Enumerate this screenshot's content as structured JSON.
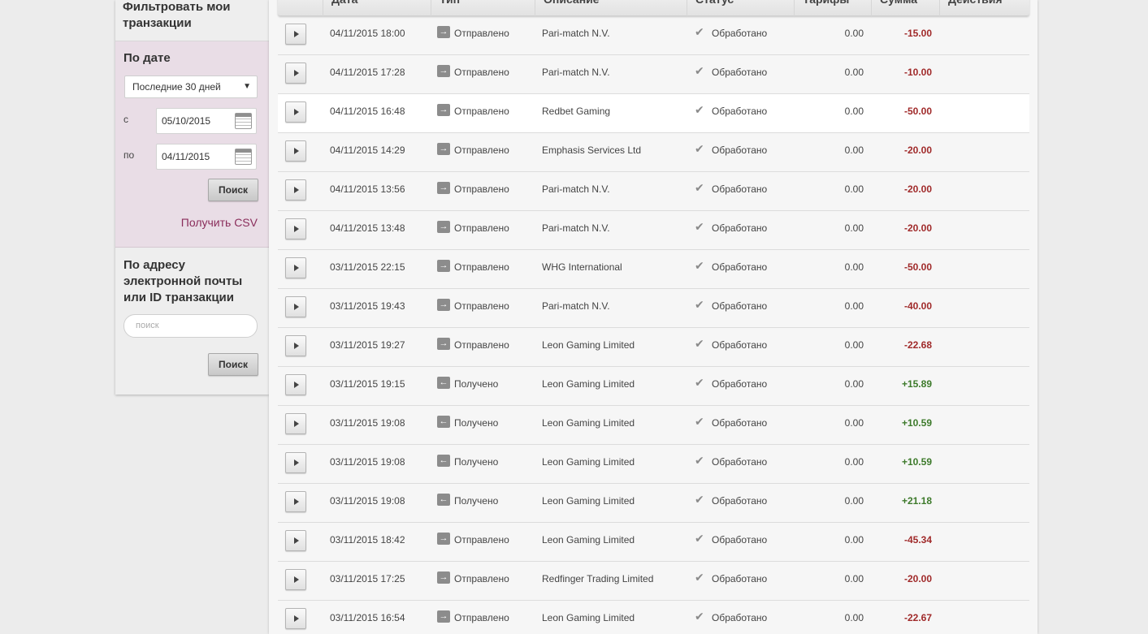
{
  "sidebar": {
    "heading": "Фильтровать мои транзакции",
    "date_section_title": "По дате",
    "period_select": "Последние 30 дней",
    "from_label": "с",
    "from_date": "05/10/2015",
    "to_label": "по",
    "to_date": "04/11/2015",
    "search_button": "Поиск",
    "csv_link": "Получить CSV",
    "email_section_title": "По адресу электронной почты или ID транзакции",
    "search_placeholder": "поиск",
    "email_search_button": "Поиск"
  },
  "table": {
    "headers": [
      "Дата",
      "Тип",
      "Описание",
      "Статус",
      "Тарифы",
      "Сумма",
      "Действия"
    ],
    "rows": [
      {
        "date": "04/11/2015 18:00",
        "type": "Отправлено",
        "dir": "out",
        "desc": "Pari-match N.V.",
        "status": "Обработано",
        "fee": "0.00",
        "amount": "-15.00"
      },
      {
        "date": "04/11/2015 17:28",
        "type": "Отправлено",
        "dir": "out",
        "desc": "Pari-match N.V.",
        "status": "Обработано",
        "fee": "0.00",
        "amount": "-10.00"
      },
      {
        "date": "04/11/2015 16:48",
        "type": "Отправлено",
        "dir": "out",
        "desc": "Redbet Gaming",
        "status": "Обработано",
        "fee": "0.00",
        "amount": "-50.00"
      },
      {
        "date": "04/11/2015 14:29",
        "type": "Отправлено",
        "dir": "out",
        "desc": "Emphasis Services Ltd",
        "status": "Обработано",
        "fee": "0.00",
        "amount": "-20.00"
      },
      {
        "date": "04/11/2015 13:56",
        "type": "Отправлено",
        "dir": "out",
        "desc": "Pari-match N.V.",
        "status": "Обработано",
        "fee": "0.00",
        "amount": "-20.00"
      },
      {
        "date": "04/11/2015 13:48",
        "type": "Отправлено",
        "dir": "out",
        "desc": "Pari-match N.V.",
        "status": "Обработано",
        "fee": "0.00",
        "amount": "-20.00"
      },
      {
        "date": "03/11/2015 22:15",
        "type": "Отправлено",
        "dir": "out",
        "desc": "WHG International",
        "status": "Обработано",
        "fee": "0.00",
        "amount": "-50.00"
      },
      {
        "date": "03/11/2015 19:43",
        "type": "Отправлено",
        "dir": "out",
        "desc": "Pari-match N.V.",
        "status": "Обработано",
        "fee": "0.00",
        "amount": "-40.00"
      },
      {
        "date": "03/11/2015 19:27",
        "type": "Отправлено",
        "dir": "out",
        "desc": "Leon Gaming Limited",
        "status": "Обработано",
        "fee": "0.00",
        "amount": "-22.68"
      },
      {
        "date": "03/11/2015 19:15",
        "type": "Получено",
        "dir": "in",
        "desc": "Leon Gaming Limited",
        "status": "Обработано",
        "fee": "0.00",
        "amount": "+15.89"
      },
      {
        "date": "03/11/2015 19:08",
        "type": "Получено",
        "dir": "in",
        "desc": "Leon Gaming Limited",
        "status": "Обработано",
        "fee": "0.00",
        "amount": "+10.59"
      },
      {
        "date": "03/11/2015 19:08",
        "type": "Получено",
        "dir": "in",
        "desc": "Leon Gaming Limited",
        "status": "Обработано",
        "fee": "0.00",
        "amount": "+10.59"
      },
      {
        "date": "03/11/2015 19:08",
        "type": "Получено",
        "dir": "in",
        "desc": "Leon Gaming Limited",
        "status": "Обработано",
        "fee": "0.00",
        "amount": "+21.18"
      },
      {
        "date": "03/11/2015 18:42",
        "type": "Отправлено",
        "dir": "out",
        "desc": "Leon Gaming Limited",
        "status": "Обработано",
        "fee": "0.00",
        "amount": "-45.34"
      },
      {
        "date": "03/11/2015 17:25",
        "type": "Отправлено",
        "dir": "out",
        "desc": "Redfinger Trading Limited",
        "status": "Обработано",
        "fee": "0.00",
        "amount": "-20.00"
      },
      {
        "date": "03/11/2015 16:54",
        "type": "Отправлено",
        "dir": "out",
        "desc": "Leon Gaming Limited",
        "status": "Обработано",
        "fee": "0.00",
        "amount": "-22.67"
      }
    ]
  },
  "colors": {
    "negative_amount": "#a02a2a",
    "positive_amount": "#3d7a2b",
    "csv_link": "#8a2d5b",
    "date_filter_bg": "#e9dde6"
  },
  "icons": {
    "sent": "arrow-right-icon",
    "received": "arrow-left-icon",
    "status": "checkmark-icon",
    "expand": "play-triangle-icon",
    "calendar": "calendar-icon"
  }
}
